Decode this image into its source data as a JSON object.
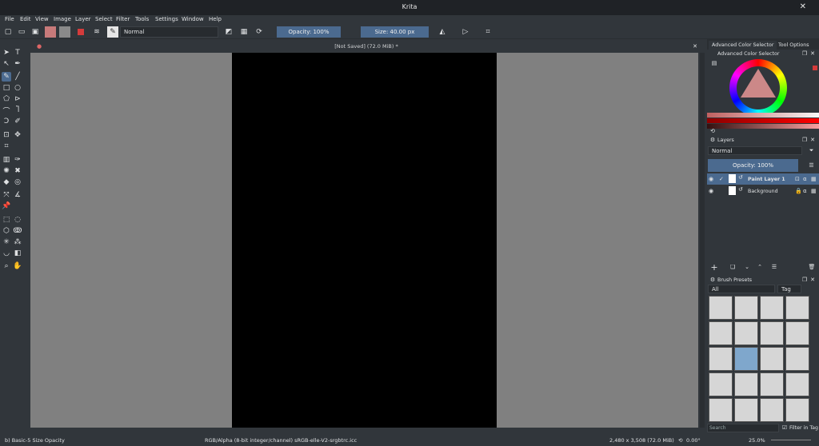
{
  "window": {
    "title": "Krita"
  },
  "menu": [
    "File",
    "Edit",
    "View",
    "Image",
    "Layer",
    "Select",
    "Filter",
    "Tools",
    "Settings",
    "Window",
    "Help"
  ],
  "toolbar": {
    "blend_mode": "Normal",
    "opacity": "Opacity: 100%",
    "size": "Size: 40.00 px"
  },
  "document": {
    "tab_title": "[Not Saved]  (72.0 MiB) *"
  },
  "dock": {
    "tabs": [
      "Advanced Color Selector",
      "Tool Options"
    ],
    "color_panel_title": "Advanced Color Selector",
    "layers_title": "Layers",
    "layers_blend": "Normal",
    "layers_opacity": "Opacity: 100%",
    "layers": [
      {
        "name": "Paint Layer 1",
        "selected": true
      },
      {
        "name": "Background",
        "selected": false
      }
    ],
    "presets_title": "Brush Presets",
    "presets_filter": "All",
    "presets_tag": "Tag",
    "search_placeholder": "Search",
    "filter_in_tag": "Filter in Tag"
  },
  "status": {
    "brush": "b) Basic-5 Size Opacity",
    "color_model": "RGB/Alpha (8-bit integer/channel)  sRGB-elle-V2-srgbtrc.icc",
    "dimensions": "2,480 x 3,508 (72.0 MiB)",
    "rotation": "0.00°",
    "zoom": "25.0%"
  },
  "colors": {
    "accent": "#4b6a8f",
    "canvas_bg": "#808080",
    "paper": "#000000"
  }
}
